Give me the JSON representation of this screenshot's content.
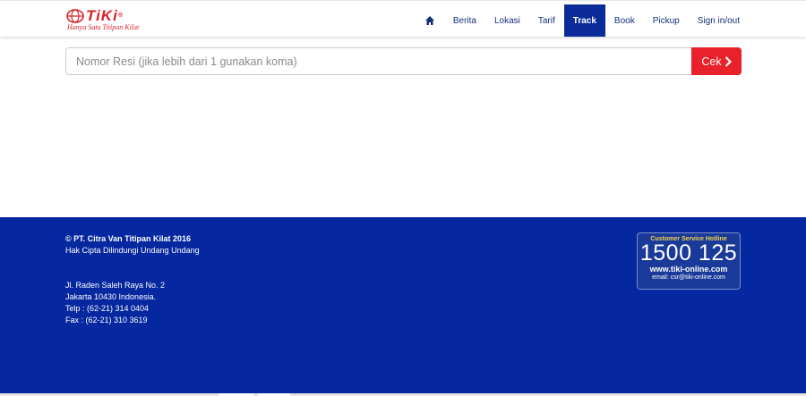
{
  "brand": {
    "name": "TiKi",
    "registered": "®",
    "tagline": "Hanya Satu Titipan Kilat"
  },
  "nav": {
    "items": [
      {
        "label": "Berita"
      },
      {
        "label": "Lokasi"
      },
      {
        "label": "Tarif"
      },
      {
        "label": "Track"
      },
      {
        "label": "Book"
      },
      {
        "label": "Pickup"
      },
      {
        "label": "Sign in/out"
      }
    ],
    "active": "Track"
  },
  "search": {
    "placeholder": "Nomor Resi (jika lebih dari 1 gunakan koma)",
    "value": "",
    "button_label": "Cek"
  },
  "footer": {
    "copyright": "© PT. Citra Van Titipan Kilat 2016",
    "rights": "Hak Cipta Dilindungi Undang Undang",
    "address_line1": "Jl. Raden Saleh Raya No. 2",
    "address_line2": "Jakarta 10430 Indonesia.",
    "phone": "Telp : (62-21) 314 0404",
    "fax": "Fax : (62-21) 310 3619"
  },
  "hotline": {
    "label": "Customer Service Hotline",
    "number": "1500 125",
    "website": "www.tiki-online.com",
    "email": "email: csr@tiki-online.com"
  },
  "colors": {
    "brand_red": "#d8232a",
    "nav_text": "#13307d",
    "nav_active_bg": "#0a2b98",
    "button_red": "#e8212b",
    "footer_blue": "#0527a0",
    "hotline_yellow": "#f2d24a"
  },
  "icons": {
    "home": "home-icon",
    "chevron": "chevron-right-icon",
    "logo_mark": "tiki-globe-icon"
  }
}
